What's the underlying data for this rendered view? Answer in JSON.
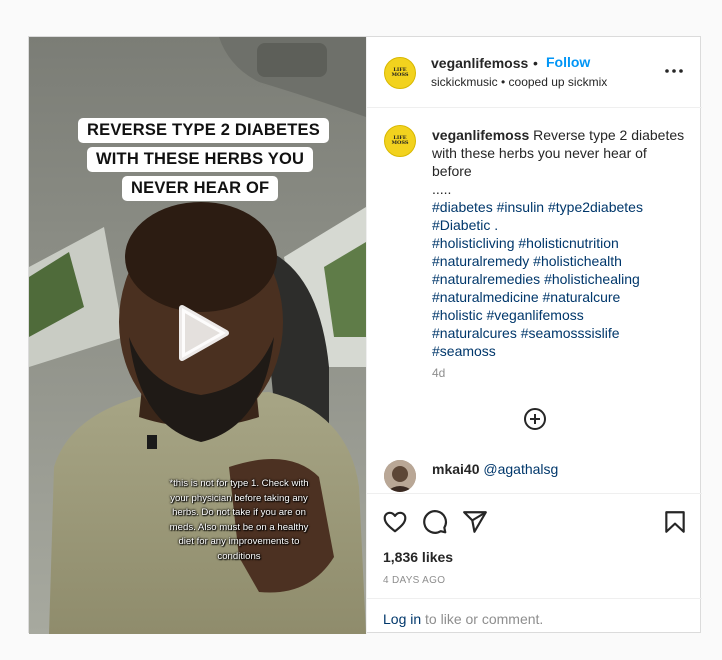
{
  "post": {
    "username": "veganlifemoss",
    "follow_label": "Follow",
    "audio": "sickickmusic • cooped up sickmix",
    "avatar_logo": "LIFE MOSS",
    "video": {
      "overlay_lines": [
        "REVERSE TYPE 2 DIABETES",
        "WITH THESE HERBS YOU",
        "NEVER HEAR OF"
      ],
      "disclaimer": "*this is not for type 1. Check with your physician before taking any herbs. Do not take if you are on meds. Also must be on a healthy diet for any improvements to conditions"
    },
    "caption": {
      "username": "veganlifemoss",
      "text": "Reverse type 2 diabetes with these herbs you never hear of before",
      "dots": ".....",
      "tag_rows": [
        [
          "#diabetes",
          "#insulin",
          "#type2diabetes"
        ],
        [
          "#Diabetic",
          "."
        ],
        [
          "#holisticliving",
          "#holisticnutrition"
        ],
        [
          "#naturalremedy",
          "#holistichealth"
        ],
        [
          "#naturalremedies",
          "#holistichealing"
        ],
        [
          "#naturalmedicine",
          "#naturalcure"
        ],
        [
          "#holistic",
          "#veganlifemoss"
        ],
        [
          "#naturalcures",
          "#seamosssislife"
        ],
        [
          "#seamoss"
        ]
      ],
      "age": "4d"
    },
    "reply": {
      "username": "mkai40",
      "mention": "@agathalsg"
    },
    "likes": "1,836 likes",
    "date": "4 DAYS AGO",
    "login_link": "Log in",
    "login_text": " to like or comment."
  },
  "icons": {
    "play": "play-icon",
    "more": "more-options-icon",
    "load_more": "add-circle-icon",
    "like": "heart-icon",
    "comment": "comment-icon",
    "share": "share-icon",
    "save": "bookmark-icon"
  },
  "colors": {
    "accent": "#0095f6",
    "link": "#00376b",
    "muted": "#8e8e8e",
    "avatar_yellow": "#f2d21e"
  }
}
